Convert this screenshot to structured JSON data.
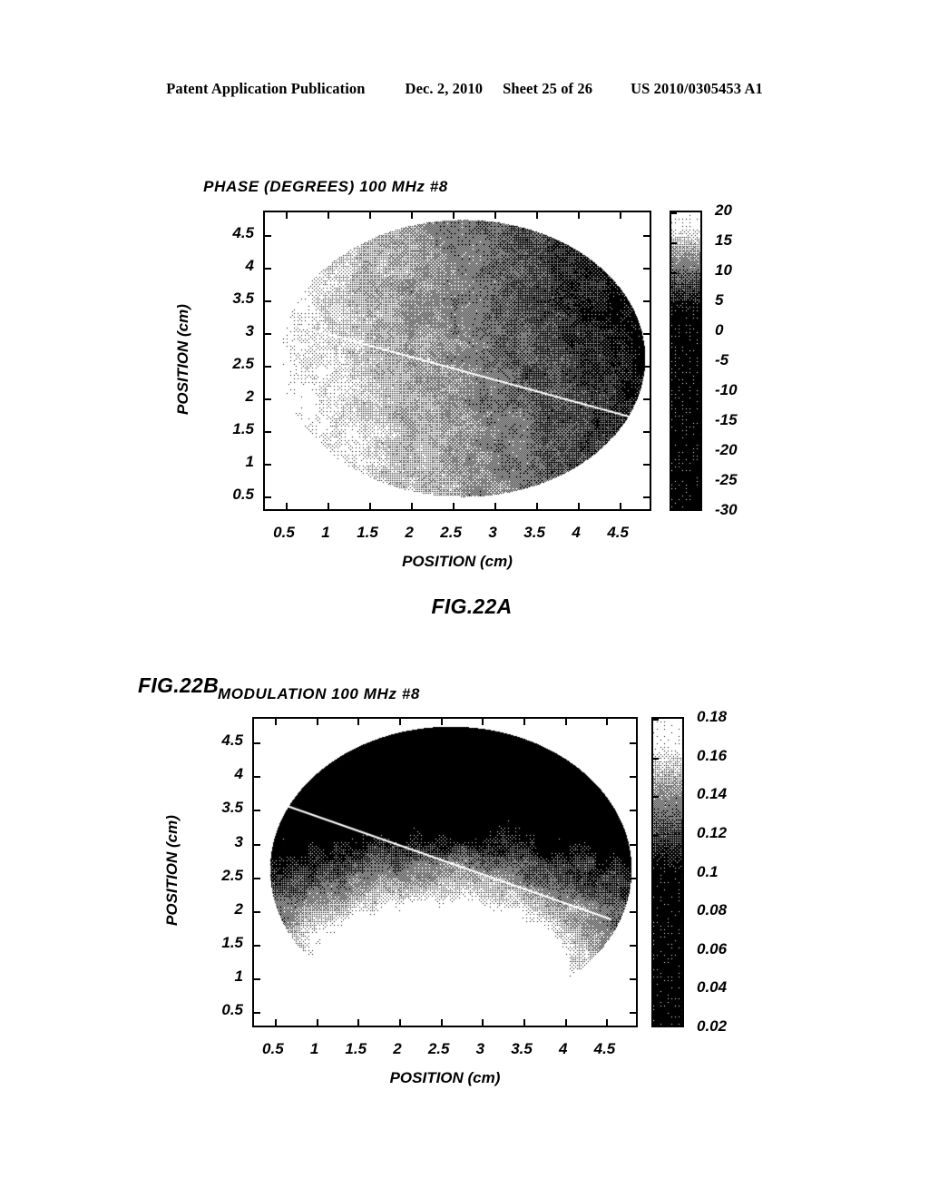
{
  "header": {
    "publication": "Patent Application Publication",
    "date": "Dec. 2, 2010",
    "sheet": "Sheet 25 of 26",
    "number": "US 2010/0305453 A1"
  },
  "figures": [
    {
      "caption": "FIG.22A",
      "caption_position": "below",
      "chart_data": {
        "type": "heatmap",
        "title": "PHASE (DEGREES)  100  MHz  #8",
        "xlabel": "POSITION  (cm)",
        "ylabel": "POSITION  (cm)",
        "xticks": [
          "0.5",
          "1",
          "1.5",
          "2",
          "2.5",
          "3",
          "3.5",
          "4",
          "4.5"
        ],
        "yticks": [
          "4.5",
          "4",
          "3.5",
          "3",
          "2.5",
          "2",
          "1.5",
          "1",
          "0.5"
        ],
        "xlim": [
          0.25,
          4.9
        ],
        "ylim": [
          0.25,
          4.85
        ],
        "grid": false,
        "colorbar": {
          "labels": [
            "20",
            "15",
            "10",
            "5",
            "0",
            "-5",
            "-10",
            "-15",
            "-20",
            "-25",
            "-30"
          ],
          "vmin": -30,
          "vmax": 20,
          "colormap": "grayscale-dithered",
          "position": "right"
        },
        "annotations": [
          {
            "kind": "line",
            "label": "diagonal-white-line",
            "color": "#ffffff",
            "x1": 0.62,
            "y1": 3.12,
            "x2": 4.62,
            "y2": 1.72
          }
        ],
        "description": "Dithered black-and-white scanned halftone of an elliptical sample region; brighter (higher phase) toward the upper-left, darker (lower phase) toward the right and lower-right, with a thin white diagonal line crossing the disc."
      }
    },
    {
      "caption": "FIG.22B",
      "caption_position": "left",
      "chart_data": {
        "type": "heatmap",
        "title": "MODULATION  100  MHz  #8",
        "xlabel": "POSITION  (cm)",
        "ylabel": "POSITION  (cm)",
        "xticks": [
          "0.5",
          "1",
          "1.5",
          "2",
          "2.5",
          "3",
          "3.5",
          "4",
          "4.5"
        ],
        "yticks": [
          "4.5",
          "4",
          "3.5",
          "3",
          "2.5",
          "2",
          "1.5",
          "1",
          "0.5"
        ],
        "xlim": [
          0.25,
          4.9
        ],
        "ylim": [
          0.25,
          4.85
        ],
        "grid": false,
        "colorbar": {
          "labels": [
            "0.18",
            "0.16",
            "0.14",
            "0.12",
            "0.1",
            "0.08",
            "0.06",
            "0.04",
            "0.02"
          ],
          "vmin": 0.01,
          "vmax": 0.19,
          "colormap": "grayscale-dithered",
          "position": "right"
        },
        "annotations": [
          {
            "kind": "line",
            "label": "diagonal-white-line",
            "color": "#ffffff",
            "x1": 0.6,
            "y1": 3.58,
            "x2": 4.55,
            "y2": 1.88
          }
        ],
        "description": "Dithered black-and-white scanned halftone of a circular sample region; solid dark (low modulation) across the upper arc, fading through dithered grey into a bright white lobe in the lower-centre, with a thin white diagonal line across the upper-left to right."
      }
    }
  ]
}
